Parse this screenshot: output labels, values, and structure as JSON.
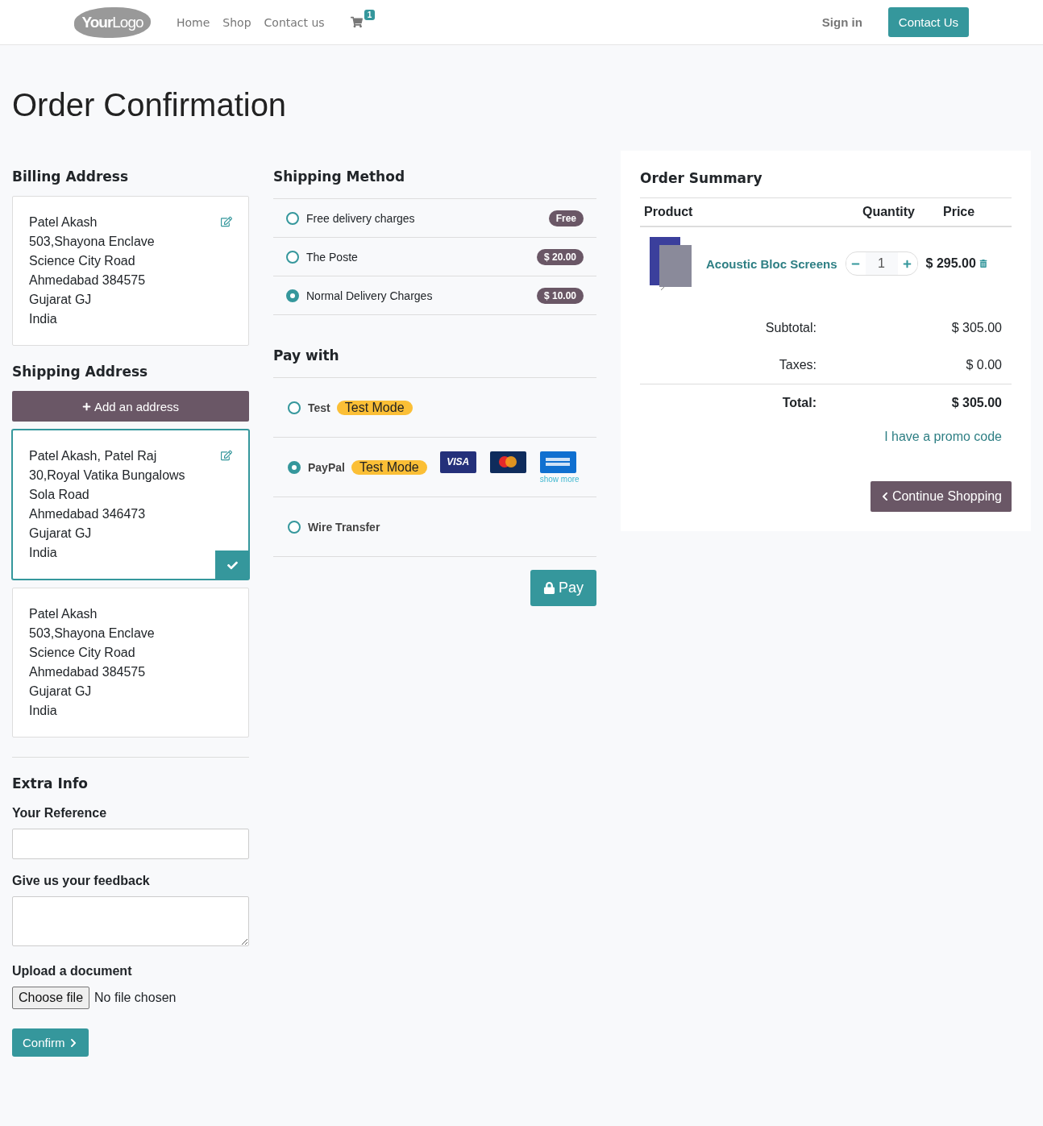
{
  "header": {
    "logo": {
      "bold": "Your",
      "light": "Logo"
    },
    "nav": [
      "Home",
      "Shop",
      "Contact us"
    ],
    "cart_count": "1",
    "sign_in": "Sign in",
    "contact_button": "Contact Us"
  },
  "title": "Order Confirmation",
  "billing": {
    "heading": "Billing Address",
    "address": {
      "editable": true,
      "selected": false,
      "lines": [
        "Patel Akash",
        "503,Shayona Enclave",
        "Science City Road",
        "Ahmedabad 384575",
        "Gujarat GJ",
        "India"
      ]
    }
  },
  "shipping": {
    "heading": "Shipping Address",
    "add_button": "Add an address",
    "addresses": [
      {
        "editable": true,
        "selected": true,
        "lines": [
          "Patel Akash, Patel Raj",
          "30,Royal Vatika Bungalows",
          "Sola Road",
          "Ahmedabad 346473",
          "Gujarat GJ",
          "India"
        ]
      },
      {
        "editable": false,
        "selected": false,
        "lines": [
          "Patel Akash",
          "503,Shayona Enclave",
          "Science City Road",
          "Ahmedabad 384575",
          "Gujarat GJ",
          "India"
        ]
      }
    ]
  },
  "extra_info": {
    "heading": "Extra Info",
    "fields": [
      {
        "kind": "input",
        "label": "Your Reference"
      },
      {
        "kind": "textarea",
        "label": "Give us your feedback"
      },
      {
        "kind": "file",
        "label": "Upload a document",
        "button": "Choose file",
        "status": "No file chosen"
      }
    ],
    "confirm_button": "Confirm"
  },
  "shipping_method": {
    "heading": "Shipping Method",
    "options": [
      {
        "name": "Free delivery charges",
        "price": "Free",
        "selected": false
      },
      {
        "name": "The Poste",
        "price": "$ 20.00",
        "selected": false
      },
      {
        "name": "Normal Delivery Charges",
        "price": "$ 10.00",
        "selected": true
      }
    ]
  },
  "pay_with": {
    "heading": "Pay with",
    "options": [
      {
        "name": "Test",
        "badge": "Test Mode",
        "selected": false
      },
      {
        "name": "PayPal",
        "badge": "Test Mode",
        "selected": true,
        "cards": [
          {
            "kind": "visa",
            "label": "VISA"
          },
          {
            "kind": "mastercard"
          },
          {
            "kind": "amex"
          }
        ],
        "show_more": "show more"
      },
      {
        "name": "Wire Transfer",
        "selected": false
      }
    ],
    "pay_button": "Pay"
  },
  "order_summary": {
    "heading": "Order Summary",
    "columns": [
      "Product",
      "Quantity",
      "Price"
    ],
    "items": [
      {
        "name": "Acoustic Bloc Screens",
        "quantity": "1",
        "price": "$ 295.00"
      }
    ],
    "totals": [
      {
        "kind": "normal",
        "label": "Subtotal:",
        "value": "$ 305.00"
      },
      {
        "kind": "normal",
        "label": "Taxes:",
        "value": "$ 0.00"
      },
      {
        "kind": "total",
        "label": "Total:",
        "value": "$ 305.00"
      }
    ],
    "promo_link": "I have a promo code",
    "continue_button": "Continue Shopping"
  }
}
